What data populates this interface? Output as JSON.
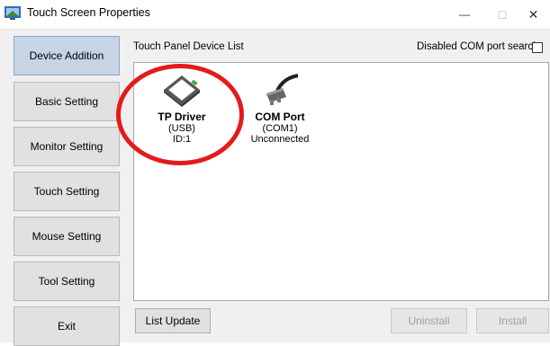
{
  "window": {
    "title": "Touch Screen Properties",
    "controls": {
      "minimize": "—",
      "maximize": "□",
      "close": "✕"
    }
  },
  "sidebar": {
    "items": [
      {
        "label": "Device Addition",
        "active": true
      },
      {
        "label": "Basic Setting"
      },
      {
        "label": "Monitor Setting"
      },
      {
        "label": "Touch Setting"
      },
      {
        "label": "Mouse Setting"
      },
      {
        "label": "Tool Setting"
      },
      {
        "label": "Exit"
      }
    ]
  },
  "main": {
    "panel_label": "Touch Panel Device List",
    "com_search_label": "Disabled COM port search",
    "com_search_checked": false,
    "devices": [
      {
        "name": "TP Driver",
        "line1": "(USB)",
        "line2": "ID:1",
        "icon": "touch-panel-icon"
      },
      {
        "name": "COM Port",
        "line1": "(COM1)",
        "line2": "Unconnected",
        "icon": "serial-cable-icon"
      }
    ],
    "buttons": {
      "list_update": "List Update",
      "uninstall": "Uninstall",
      "install": "Install"
    }
  },
  "colors": {
    "highlight_circle": "#e31b1b",
    "active_tab": "#c7d4e6"
  }
}
